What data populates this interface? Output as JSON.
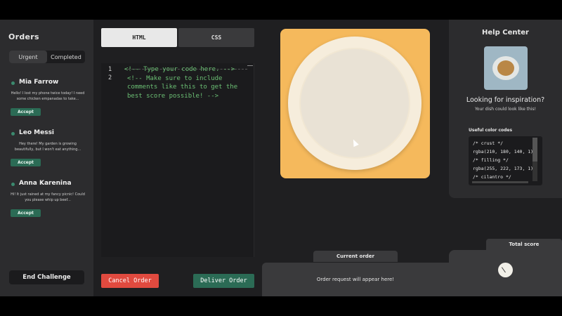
{
  "orders": {
    "title": "Orders",
    "tabs": [
      "Urgent",
      "Completed"
    ],
    "items": [
      {
        "name": "Mia Farrow",
        "message": "Hello! I lost my phone twice today! I need some chicken empanadas to take...",
        "accept": "Accept"
      },
      {
        "name": "Leo Messi",
        "message": "Hey there! My garden is growing beautifully, but I won't eat anything...",
        "accept": "Accept"
      },
      {
        "name": "Anna Karenina",
        "message": "Hi! It just rained at my fancy picnic! Could you please whip up beef...",
        "accept": "Accept"
      }
    ],
    "end_button": "End Challenge"
  },
  "editor": {
    "tabs": {
      "html": "HTML",
      "css": "CSS"
    },
    "line_numbers": [
      "1",
      "2"
    ],
    "code_lines": [
      "<!-- Type your code here. -->",
      "<!-- Make sure to include",
      "comments like this to get the",
      "best score possible! -->"
    ],
    "cancel": "Cancel Order",
    "deliver": "Deliver Order"
  },
  "preview": {
    "current_order_label": "Current order",
    "request_text": "Order request will appear here!"
  },
  "help": {
    "title": "Help Center",
    "question": "Looking for inspiration?",
    "subtitle": "Your dish could look like this!",
    "colors_label": "Useful color codes",
    "color_lines": [
      "/* crust */",
      "rgba(210, 180, 140, 1)",
      "/* filling */",
      "rgba(255, 222, 173, 1)",
      "/* cilantro */"
    ]
  },
  "score": {
    "label": "Total score"
  },
  "colors": {
    "accent_green": "#2b6b55",
    "cancel_red": "#e04a3f",
    "canvas_orange": "#f5b95c"
  }
}
